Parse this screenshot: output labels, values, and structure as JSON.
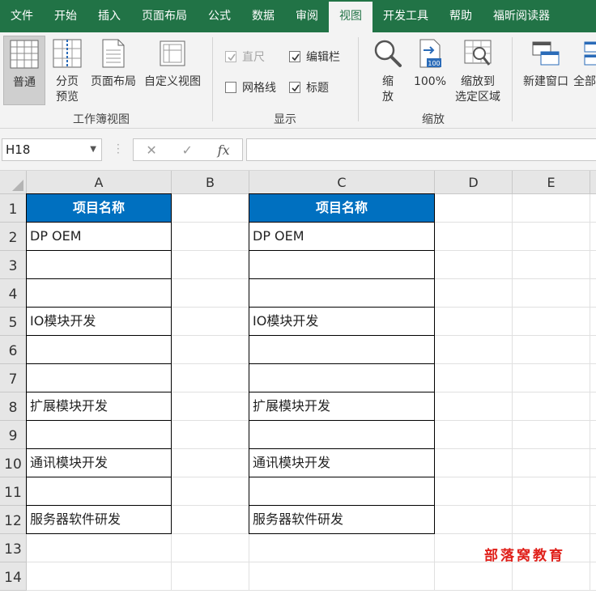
{
  "tabs": [
    "文件",
    "开始",
    "插入",
    "页面布局",
    "公式",
    "数据",
    "审阅",
    "视图",
    "开发工具",
    "帮助",
    "福昕阅读器"
  ],
  "active_tab": "视图",
  "ribbon": {
    "workbook_views": {
      "label": "工作簿视图",
      "normal": "普通",
      "page_break_1": "分页",
      "page_break_2": "预览",
      "page_layout": "页面布局",
      "custom_views": "自定义视图"
    },
    "show": {
      "label": "显示",
      "ruler": "直尺",
      "formula_bar": "编辑栏",
      "gridlines": "网格线",
      "headings": "标题",
      "ruler_checked": true,
      "formula_bar_checked": true,
      "gridlines_checked": false,
      "headings_checked": true
    },
    "zoom": {
      "label": "缩放",
      "zoom_1": "缩",
      "zoom_2": "放",
      "hundred": "100%",
      "zoom_sel_1": "缩放到",
      "zoom_sel_2": "选定区域",
      "hundred_icon_text": "100"
    },
    "window": {
      "new_window": "新建窗口",
      "all": "全部"
    }
  },
  "formula_bar": {
    "name_box": "H18",
    "formula": "",
    "cancel_symbol": "✕",
    "enter_symbol": "✓",
    "fx_symbol": "fx"
  },
  "columns": [
    "A",
    "B",
    "C",
    "D",
    "E"
  ],
  "rows": [
    "1",
    "2",
    "3",
    "4",
    "5",
    "6",
    "7",
    "8",
    "9",
    "10",
    "11",
    "12",
    "13",
    "14"
  ],
  "table_a": {
    "header": "项目名称",
    "cells": [
      "DP OEM",
      "",
      "",
      "IO模块开发",
      "",
      "",
      "扩展模块开发",
      "",
      "通讯模块开发",
      "",
      "服务器软件研发"
    ]
  },
  "table_c": {
    "header": "项目名称",
    "cells": [
      "DP OEM",
      "",
      "",
      "IO模块开发",
      "",
      "",
      "扩展模块开发",
      "",
      "通讯模块开发",
      "",
      "服务器软件研发"
    ]
  },
  "watermark": "部落窝教育",
  "colors": {
    "accent_green": "#217346",
    "header_blue": "#0070c0",
    "watermark_red": "#e0201a"
  }
}
